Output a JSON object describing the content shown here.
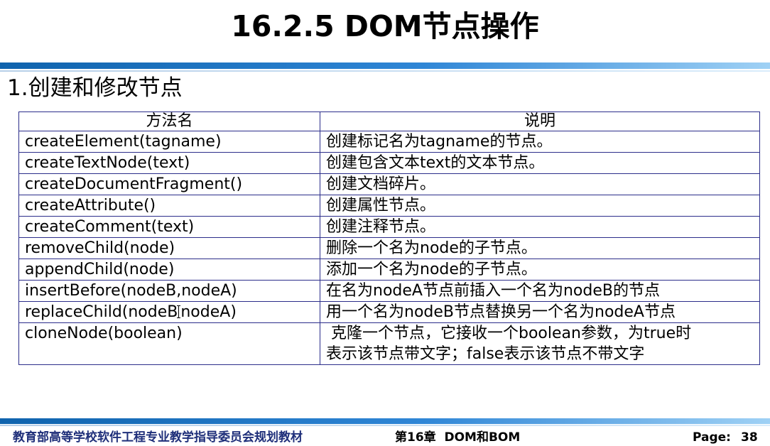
{
  "slide": {
    "title": "16.2.5 DOM节点操作",
    "section_heading": "1.创建和修改节点"
  },
  "table": {
    "headers": [
      "方法名",
      "说明"
    ],
    "rows": [
      {
        "method": "createElement(tagname)",
        "description": "创建标记名为tagname的节点。"
      },
      {
        "method": "createTextNode(text)",
        "description": "创建包含文本text的文本节点。"
      },
      {
        "method": "createDocumentFragment()",
        "description": "创建文档碎片。"
      },
      {
        "method": "createAttribute()",
        "description": "创建属性节点。"
      },
      {
        "method": "createComment(text)",
        "description": "创建注释节点。"
      },
      {
        "method": "removeChild(node)",
        "description": "删除一个名为node的子节点。"
      },
      {
        "method": "appendChild(node)",
        "description": "添加一个名为node的子节点。"
      },
      {
        "method": "insertBefore(nodeB,nodeA)",
        "description": "在名为nodeA节点前插入一个名为nodeB的节点"
      },
      {
        "method_before_cursor": "replaceChild(nodeB",
        "method_after_cursor": "nodeA)",
        "description": "用一个名为nodeB节点替换另一个名为nodeA节点"
      },
      {
        "method": "cloneNode(boolean)",
        "description_line1": " 克隆一个节点，它接收一个boolean参数，为true时",
        "description_line2": "表示该节点带文字；false表示该节点不带文字"
      }
    ]
  },
  "footer": {
    "left_text": "教育部高等学校软件工程专业教学指导委员会规划教材",
    "center_text": "第16章  DOM和BOM",
    "page_label": "Page:",
    "page_number": "38"
  },
  "colors": {
    "title_text": "#000000",
    "rule_blue": "#0f63ad",
    "table_border": "#2b2d8a",
    "footer_left_text": "#1f2f7a"
  },
  "icons": {
    "cursor": "text-cursor-icon"
  }
}
